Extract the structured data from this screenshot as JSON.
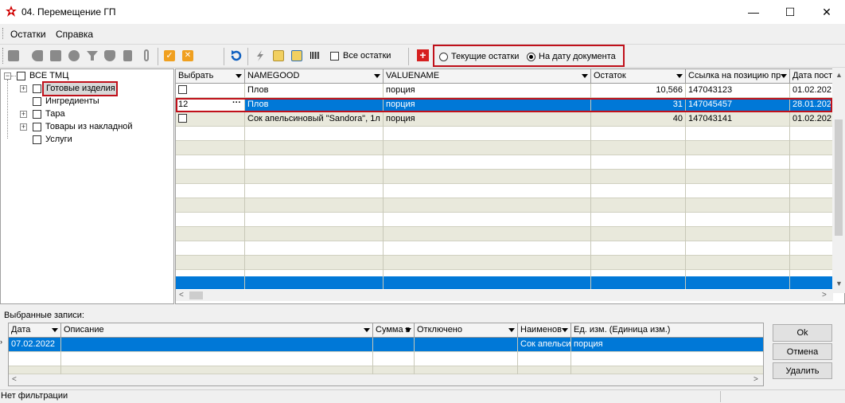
{
  "window": {
    "title": "04. Перемещение ГП",
    "minimize": "—",
    "maximize": "☐",
    "close": "✕"
  },
  "menu": [
    "Остатки",
    "Справка"
  ],
  "toolbar": {
    "all_stock_label": "Все остатки",
    "radio_current": "Текущие остатки",
    "radio_doc_date": "На дату документа",
    "radio_selected": "doc_date"
  },
  "tree": {
    "root": "ВСЕ ТМЦ",
    "items": [
      {
        "label": "Готовые изделия",
        "expandable": true
      },
      {
        "label": "Ингредиенты",
        "expandable": false
      },
      {
        "label": "Тара",
        "expandable": true
      },
      {
        "label": "Товары из накладной",
        "expandable": true
      },
      {
        "label": "Услуги",
        "expandable": false
      }
    ]
  },
  "main_grid": {
    "columns": [
      "Выбрать",
      "NAMEGOOD",
      "VALUENAME",
      "Остаток",
      "Ссылка на позицию пр",
      "Дата пост"
    ],
    "rows": [
      {
        "select": "",
        "namegood": "Плов",
        "valuename": "порция",
        "ostatok": "10,566",
        "link": "147043123",
        "date": "01.02.202"
      },
      {
        "select": "12",
        "namegood": "Плов",
        "valuename": "порция",
        "ostatok": "31",
        "link": "147045457",
        "date": "28.01.202"
      },
      {
        "select": "",
        "namegood": "Сок апельсиновый \"Sandora\", 1л (",
        "valuename": "порция",
        "ostatok": "40",
        "link": "147043141",
        "date": "01.02.202"
      }
    ],
    "edit_button": "···"
  },
  "selected_section": {
    "label": "Выбранные записи:",
    "columns": [
      "Дата",
      "Описание",
      "Сумма в",
      "Отключено",
      "Наименов",
      "Ед. изм. (Единица изм.)"
    ],
    "rows": [
      {
        "date": "07.02.2022",
        "desc": "",
        "sum": "",
        "disabled": "",
        "name": "Сок апельси",
        "unit": "порция"
      }
    ]
  },
  "buttons": {
    "ok": "Ok",
    "cancel": "Отмена",
    "delete": "Удалить"
  },
  "status": {
    "text": "Нет фильтрации"
  },
  "colors": {
    "selection": "#0078d7",
    "highlight_border": "#c0101a",
    "row_alt": "#e9e9dc"
  }
}
